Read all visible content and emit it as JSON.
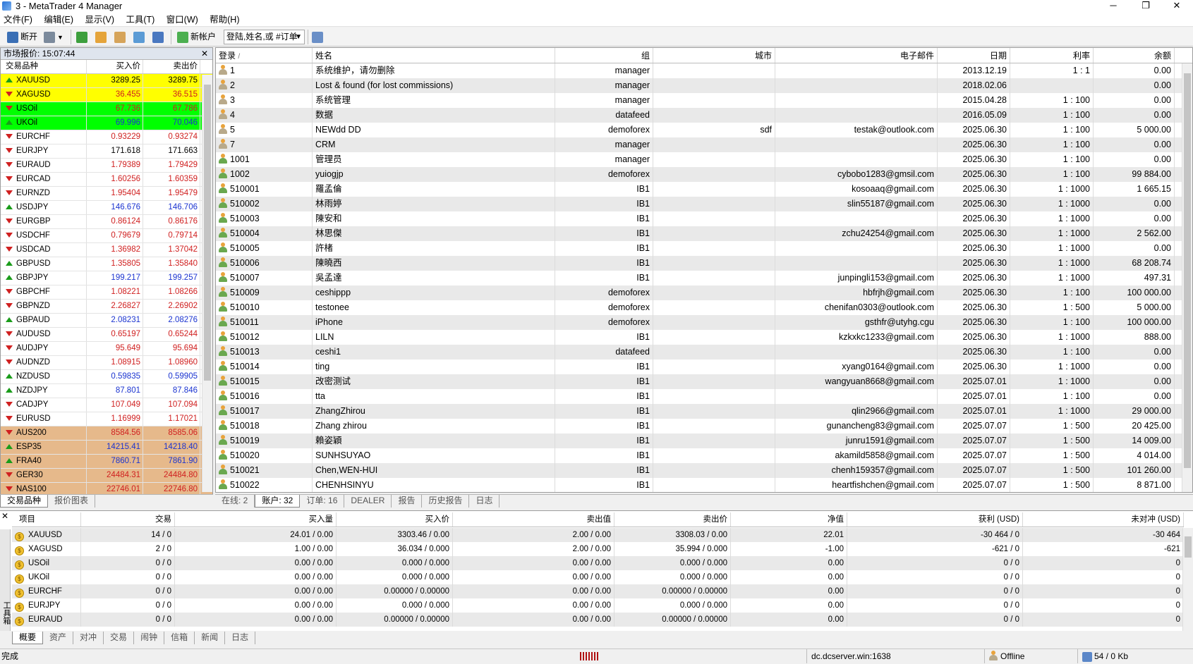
{
  "window": {
    "title": "3 - MetaTrader 4 Manager",
    "min": "─",
    "max": "❐",
    "close": "✕"
  },
  "menu": [
    "文件(F)",
    "编辑(E)",
    "显示(V)",
    "工具(T)",
    "窗口(W)",
    "帮助(H)"
  ],
  "toolbar": {
    "disconnect": "断开",
    "new_account": "新帐户",
    "search_placeholder": "登陆,姓名,或 #订单"
  },
  "market_watch": {
    "header": "市场报价: 15:07:44",
    "close": "✕",
    "columns": [
      "交易品种",
      "买入价",
      "卖出价"
    ],
    "rows": [
      {
        "symbol": "XAUUSD",
        "bid": "3289.25",
        "ask": "3289.75",
        "dir": "up",
        "bg": "#ffff00",
        "color": "#000"
      },
      {
        "symbol": "XAGUSD",
        "bid": "36.455",
        "ask": "36.515",
        "dir": "down",
        "bg": "#ffff00",
        "color": "#d02020"
      },
      {
        "symbol": "USOil",
        "bid": "67.736",
        "ask": "67.786",
        "dir": "down",
        "bg": "#00ff00",
        "color": "#d02020"
      },
      {
        "symbol": "UKOil",
        "bid": "69.996",
        "ask": "70.046",
        "dir": "up",
        "bg": "#00ff00",
        "color": "#1a33d0"
      },
      {
        "symbol": "EURCHF",
        "bid": "0.93229",
        "ask": "0.93274",
        "dir": "down",
        "bg": "#ffffff",
        "color": "#d02020"
      },
      {
        "symbol": "EURJPY",
        "bid": "171.618",
        "ask": "171.663",
        "dir": "down",
        "bg": "#ffffff",
        "color": "#000"
      },
      {
        "symbol": "EURAUD",
        "bid": "1.79389",
        "ask": "1.79429",
        "dir": "down",
        "bg": "#ffffff",
        "color": "#d02020"
      },
      {
        "symbol": "EURCAD",
        "bid": "1.60256",
        "ask": "1.60359",
        "dir": "down",
        "bg": "#ffffff",
        "color": "#d02020"
      },
      {
        "symbol": "EURNZD",
        "bid": "1.95404",
        "ask": "1.95479",
        "dir": "down",
        "bg": "#ffffff",
        "color": "#d02020"
      },
      {
        "symbol": "USDJPY",
        "bid": "146.676",
        "ask": "146.706",
        "dir": "up",
        "bg": "#ffffff",
        "color": "#1a33d0"
      },
      {
        "symbol": "EURGBP",
        "bid": "0.86124",
        "ask": "0.86176",
        "dir": "down",
        "bg": "#ffffff",
        "color": "#d02020"
      },
      {
        "symbol": "USDCHF",
        "bid": "0.79679",
        "ask": "0.79714",
        "dir": "down",
        "bg": "#ffffff",
        "color": "#d02020"
      },
      {
        "symbol": "USDCAD",
        "bid": "1.36982",
        "ask": "1.37042",
        "dir": "down",
        "bg": "#ffffff",
        "color": "#d02020"
      },
      {
        "symbol": "GBPUSD",
        "bid": "1.35805",
        "ask": "1.35840",
        "dir": "up",
        "bg": "#ffffff",
        "color": "#d02020"
      },
      {
        "symbol": "GBPJPY",
        "bid": "199.217",
        "ask": "199.257",
        "dir": "up",
        "bg": "#ffffff",
        "color": "#1a33d0"
      },
      {
        "symbol": "GBPCHF",
        "bid": "1.08221",
        "ask": "1.08266",
        "dir": "down",
        "bg": "#ffffff",
        "color": "#d02020"
      },
      {
        "symbol": "GBPNZD",
        "bid": "2.26827",
        "ask": "2.26902",
        "dir": "down",
        "bg": "#ffffff",
        "color": "#d02020"
      },
      {
        "symbol": "GBPAUD",
        "bid": "2.08231",
        "ask": "2.08276",
        "dir": "up",
        "bg": "#ffffff",
        "color": "#1a33d0"
      },
      {
        "symbol": "AUDUSD",
        "bid": "0.65197",
        "ask": "0.65244",
        "dir": "down",
        "bg": "#ffffff",
        "color": "#d02020"
      },
      {
        "symbol": "AUDJPY",
        "bid": "95.649",
        "ask": "95.694",
        "dir": "down",
        "bg": "#ffffff",
        "color": "#d02020"
      },
      {
        "symbol": "AUDNZD",
        "bid": "1.08915",
        "ask": "1.08960",
        "dir": "down",
        "bg": "#ffffff",
        "color": "#d02020"
      },
      {
        "symbol": "NZDUSD",
        "bid": "0.59835",
        "ask": "0.59905",
        "dir": "up",
        "bg": "#ffffff",
        "color": "#1a33d0"
      },
      {
        "symbol": "NZDJPY",
        "bid": "87.801",
        "ask": "87.846",
        "dir": "up",
        "bg": "#ffffff",
        "color": "#1a33d0"
      },
      {
        "symbol": "CADJPY",
        "bid": "107.049",
        "ask": "107.094",
        "dir": "down",
        "bg": "#ffffff",
        "color": "#d02020"
      },
      {
        "symbol": "EURUSD",
        "bid": "1.16999",
        "ask": "1.17021",
        "dir": "down",
        "bg": "#ffffff",
        "color": "#d02020"
      },
      {
        "symbol": "AUS200",
        "bid": "8584.56",
        "ask": "8585.06",
        "dir": "down",
        "bg": "#e6b98b",
        "color": "#d02020"
      },
      {
        "symbol": "ESP35",
        "bid": "14215.41",
        "ask": "14218.40",
        "dir": "up",
        "bg": "#e6b98b",
        "color": "#1a33d0"
      },
      {
        "symbol": "FRA40",
        "bid": "7860.71",
        "ask": "7861.90",
        "dir": "up",
        "bg": "#e6b98b",
        "color": "#1a33d0"
      },
      {
        "symbol": "GER30",
        "bid": "24484.31",
        "ask": "24484.80",
        "dir": "down",
        "bg": "#e6b98b",
        "color": "#d02020"
      },
      {
        "symbol": "NAS100",
        "bid": "22746.01",
        "ask": "22746.80",
        "dir": "down",
        "bg": "#e6b98b",
        "color": "#d02020"
      }
    ],
    "tabs": [
      "交易品种",
      "报价图表"
    ]
  },
  "accounts": {
    "columns": [
      "登录",
      "姓名",
      "组",
      "城市",
      "电子邮件",
      "日期",
      "利率",
      "余额"
    ],
    "rows": [
      {
        "login": "1",
        "name": "系统维护，请勿删除",
        "group": "manager",
        "city": "",
        "email": "",
        "date": "2013.12.19",
        "leverage": "1 : 1",
        "balance": "0.00"
      },
      {
        "login": "2",
        "name": "Lost & found (for lost commissions)",
        "group": "manager",
        "city": "",
        "email": "",
        "date": "2018.02.06",
        "leverage": "",
        "balance": "0.00"
      },
      {
        "login": "3",
        "name": "系统管理",
        "group": "manager",
        "city": "",
        "email": "",
        "date": "2015.04.28",
        "leverage": "1 : 100",
        "balance": "0.00"
      },
      {
        "login": "4",
        "name": "数据",
        "group": "datafeed",
        "city": "",
        "email": "",
        "date": "2016.05.09",
        "leverage": "1 : 100",
        "balance": "0.00"
      },
      {
        "login": "5",
        "name": "NEWdd DD",
        "group": "demoforex",
        "city": "sdf",
        "email": "testak@outlook.com",
        "date": "2025.06.30",
        "leverage": "1 : 100",
        "balance": "5 000.00"
      },
      {
        "login": "7",
        "name": "CRM",
        "group": "manager",
        "city": "",
        "email": "",
        "date": "2025.06.30",
        "leverage": "1 : 100",
        "balance": "0.00"
      },
      {
        "login": "1001",
        "name": "管理员",
        "group": "manager",
        "city": "",
        "email": "",
        "date": "2025.06.30",
        "leverage": "1 : 100",
        "balance": "0.00"
      },
      {
        "login": "1002",
        "name": "yuiogjp",
        "group": "demoforex",
        "city": "",
        "email": "cybobo1283@gmsil.com",
        "date": "2025.06.30",
        "leverage": "1 : 100",
        "balance": "99 884.00"
      },
      {
        "login": "510001",
        "name": "羅孟倫",
        "group": "IB1",
        "city": "",
        "email": "kosoaaq@gmail.com",
        "date": "2025.06.30",
        "leverage": "1 : 1000",
        "balance": "1 665.15"
      },
      {
        "login": "510002",
        "name": "林雨婷",
        "group": "IB1",
        "city": "",
        "email": "slin55187@gmail.com",
        "date": "2025.06.30",
        "leverage": "1 : 1000",
        "balance": "0.00"
      },
      {
        "login": "510003",
        "name": "陳安和",
        "group": "IB1",
        "city": "",
        "email": "",
        "date": "2025.06.30",
        "leverage": "1 : 1000",
        "balance": "0.00"
      },
      {
        "login": "510004",
        "name": "林思傑",
        "group": "IB1",
        "city": "",
        "email": "zchu24254@gmail.com",
        "date": "2025.06.30",
        "leverage": "1 : 1000",
        "balance": "2 562.00"
      },
      {
        "login": "510005",
        "name": "許楮",
        "group": "IB1",
        "city": "",
        "email": "",
        "date": "2025.06.30",
        "leverage": "1 : 1000",
        "balance": "0.00"
      },
      {
        "login": "510006",
        "name": "陳曉西",
        "group": "IB1",
        "city": "",
        "email": "",
        "date": "2025.06.30",
        "leverage": "1 : 1000",
        "balance": "68 208.74"
      },
      {
        "login": "510007",
        "name": "吳孟達",
        "group": "IB1",
        "city": "",
        "email": "junpingli153@gmail.com",
        "date": "2025.06.30",
        "leverage": "1 : 1000",
        "balance": "497.31"
      },
      {
        "login": "510009",
        "name": "ceshippp",
        "group": "demoforex",
        "city": "",
        "email": "hbfrjh@gmail.com",
        "date": "2025.06.30",
        "leverage": "1 : 100",
        "balance": "100 000.00"
      },
      {
        "login": "510010",
        "name": "testonee",
        "group": "demoforex",
        "city": "",
        "email": "chenifan0303@outlook.com",
        "date": "2025.06.30",
        "leverage": "1 : 500",
        "balance": "5 000.00"
      },
      {
        "login": "510011",
        "name": "iPhone",
        "group": "demoforex",
        "city": "",
        "email": "gsthfr@utyhg.cgu",
        "date": "2025.06.30",
        "leverage": "1 : 100",
        "balance": "100 000.00"
      },
      {
        "login": "510012",
        "name": "LILN",
        "group": "IB1",
        "city": "",
        "email": "kzkxkc1233@gmail.com",
        "date": "2025.06.30",
        "leverage": "1 : 1000",
        "balance": "888.00"
      },
      {
        "login": "510013",
        "name": "ceshi1",
        "group": "datafeed",
        "city": "",
        "email": "",
        "date": "2025.06.30",
        "leverage": "1 : 100",
        "balance": "0.00"
      },
      {
        "login": "510014",
        "name": "ting",
        "group": "IB1",
        "city": "",
        "email": "xyang0164@gmail.com",
        "date": "2025.06.30",
        "leverage": "1 : 1000",
        "balance": "0.00"
      },
      {
        "login": "510015",
        "name": "改密测试",
        "group": "IB1",
        "city": "",
        "email": "wangyuan8668@gmail.com",
        "date": "2025.07.01",
        "leverage": "1 : 1000",
        "balance": "0.00"
      },
      {
        "login": "510016",
        "name": "tta",
        "group": "IB1",
        "city": "",
        "email": "",
        "date": "2025.07.01",
        "leverage": "1 : 100",
        "balance": "0.00"
      },
      {
        "login": "510017",
        "name": "ZhangZhirou",
        "group": "IB1",
        "city": "",
        "email": "qlin2966@gmail.com",
        "date": "2025.07.01",
        "leverage": "1 : 1000",
        "balance": "29 000.00"
      },
      {
        "login": "510018",
        "name": "Zhang zhirou",
        "group": "IB1",
        "city": "",
        "email": "gunancheng83@gmail.com",
        "date": "2025.07.07",
        "leverage": "1 : 500",
        "balance": "20 425.00"
      },
      {
        "login": "510019",
        "name": "賴姿穎",
        "group": "IB1",
        "city": "",
        "email": "junru1591@gmail.com",
        "date": "2025.07.07",
        "leverage": "1 : 500",
        "balance": "14 009.00"
      },
      {
        "login": "510020",
        "name": "SUNHSUYAO",
        "group": "IB1",
        "city": "",
        "email": "akamild5858@gmail.com",
        "date": "2025.07.07",
        "leverage": "1 : 500",
        "balance": "4 014.00"
      },
      {
        "login": "510021",
        "name": "Chen,WEN-HUI",
        "group": "IB1",
        "city": "",
        "email": "chenh159357@gmail.com",
        "date": "2025.07.07",
        "leverage": "1 : 500",
        "balance": "101 260.00"
      },
      {
        "login": "510022",
        "name": "CHENHSINYU",
        "group": "IB1",
        "city": "",
        "email": "heartfishchen@gmail.com",
        "date": "2025.07.07",
        "leverage": "1 : 500",
        "balance": "8 871.00"
      }
    ],
    "tabs": [
      "在线: 2",
      "账户: 32",
      "订单: 16",
      "DEALER",
      "报告",
      "历史报告",
      "日志"
    ]
  },
  "summary": {
    "columns": [
      "项目",
      "交易",
      "买入量",
      "买入价",
      "卖出值",
      "卖出价",
      "净值",
      "获利 (USD)",
      "未对冲 (USD)"
    ],
    "rows": [
      {
        "item": "XAUUSD",
        "trades": "14 / 0",
        "buy_vol": "24.01 / 0.00",
        "buy_price": "3303.46 / 0.00",
        "sell_vol": "2.00 / 0.00",
        "sell_price": "3308.03 / 0.00",
        "net": "22.01",
        "profit": "-30 464 / 0",
        "uncovered": "-30 464"
      },
      {
        "item": "XAGUSD",
        "trades": "2 / 0",
        "buy_vol": "1.00 / 0.00",
        "buy_price": "36.034 / 0.000",
        "sell_vol": "2.00 / 0.00",
        "sell_price": "35.994 / 0.000",
        "net": "-1.00",
        "profit": "-621 / 0",
        "uncovered": "-621"
      },
      {
        "item": "USOil",
        "trades": "0 / 0",
        "buy_vol": "0.00 / 0.00",
        "buy_price": "0.000 / 0.000",
        "sell_vol": "0.00 / 0.00",
        "sell_price": "0.000 / 0.000",
        "net": "0.00",
        "profit": "0 / 0",
        "uncovered": "0"
      },
      {
        "item": "UKOil",
        "trades": "0 / 0",
        "buy_vol": "0.00 / 0.00",
        "buy_price": "0.000 / 0.000",
        "sell_vol": "0.00 / 0.00",
        "sell_price": "0.000 / 0.000",
        "net": "0.00",
        "profit": "0 / 0",
        "uncovered": "0"
      },
      {
        "item": "EURCHF",
        "trades": "0 / 0",
        "buy_vol": "0.00 / 0.00",
        "buy_price": "0.00000 / 0.00000",
        "sell_vol": "0.00 / 0.00",
        "sell_price": "0.00000 / 0.00000",
        "net": "0.00",
        "profit": "0 / 0",
        "uncovered": "0"
      },
      {
        "item": "EURJPY",
        "trades": "0 / 0",
        "buy_vol": "0.00 / 0.00",
        "buy_price": "0.000 / 0.000",
        "sell_vol": "0.00 / 0.00",
        "sell_price": "0.000 / 0.000",
        "net": "0.00",
        "profit": "0 / 0",
        "uncovered": "0"
      },
      {
        "item": "EURAUD",
        "trades": "0 / 0",
        "buy_vol": "0.00 / 0.00",
        "buy_price": "0.00000 / 0.00000",
        "sell_vol": "0.00 / 0.00",
        "sell_price": "0.00000 / 0.00000",
        "net": "0.00",
        "profit": "0 / 0",
        "uncovered": "0"
      }
    ],
    "tabs": [
      "概要",
      "资产",
      "对冲",
      "交易",
      "闹钟",
      "信箱",
      "新闻",
      "日志"
    ],
    "side_label": "工具箱"
  },
  "status": {
    "left": "完成",
    "server": "dc.dcserver.win:1638",
    "conn": "Offline",
    "traffic": "54 / 0 Kb"
  }
}
